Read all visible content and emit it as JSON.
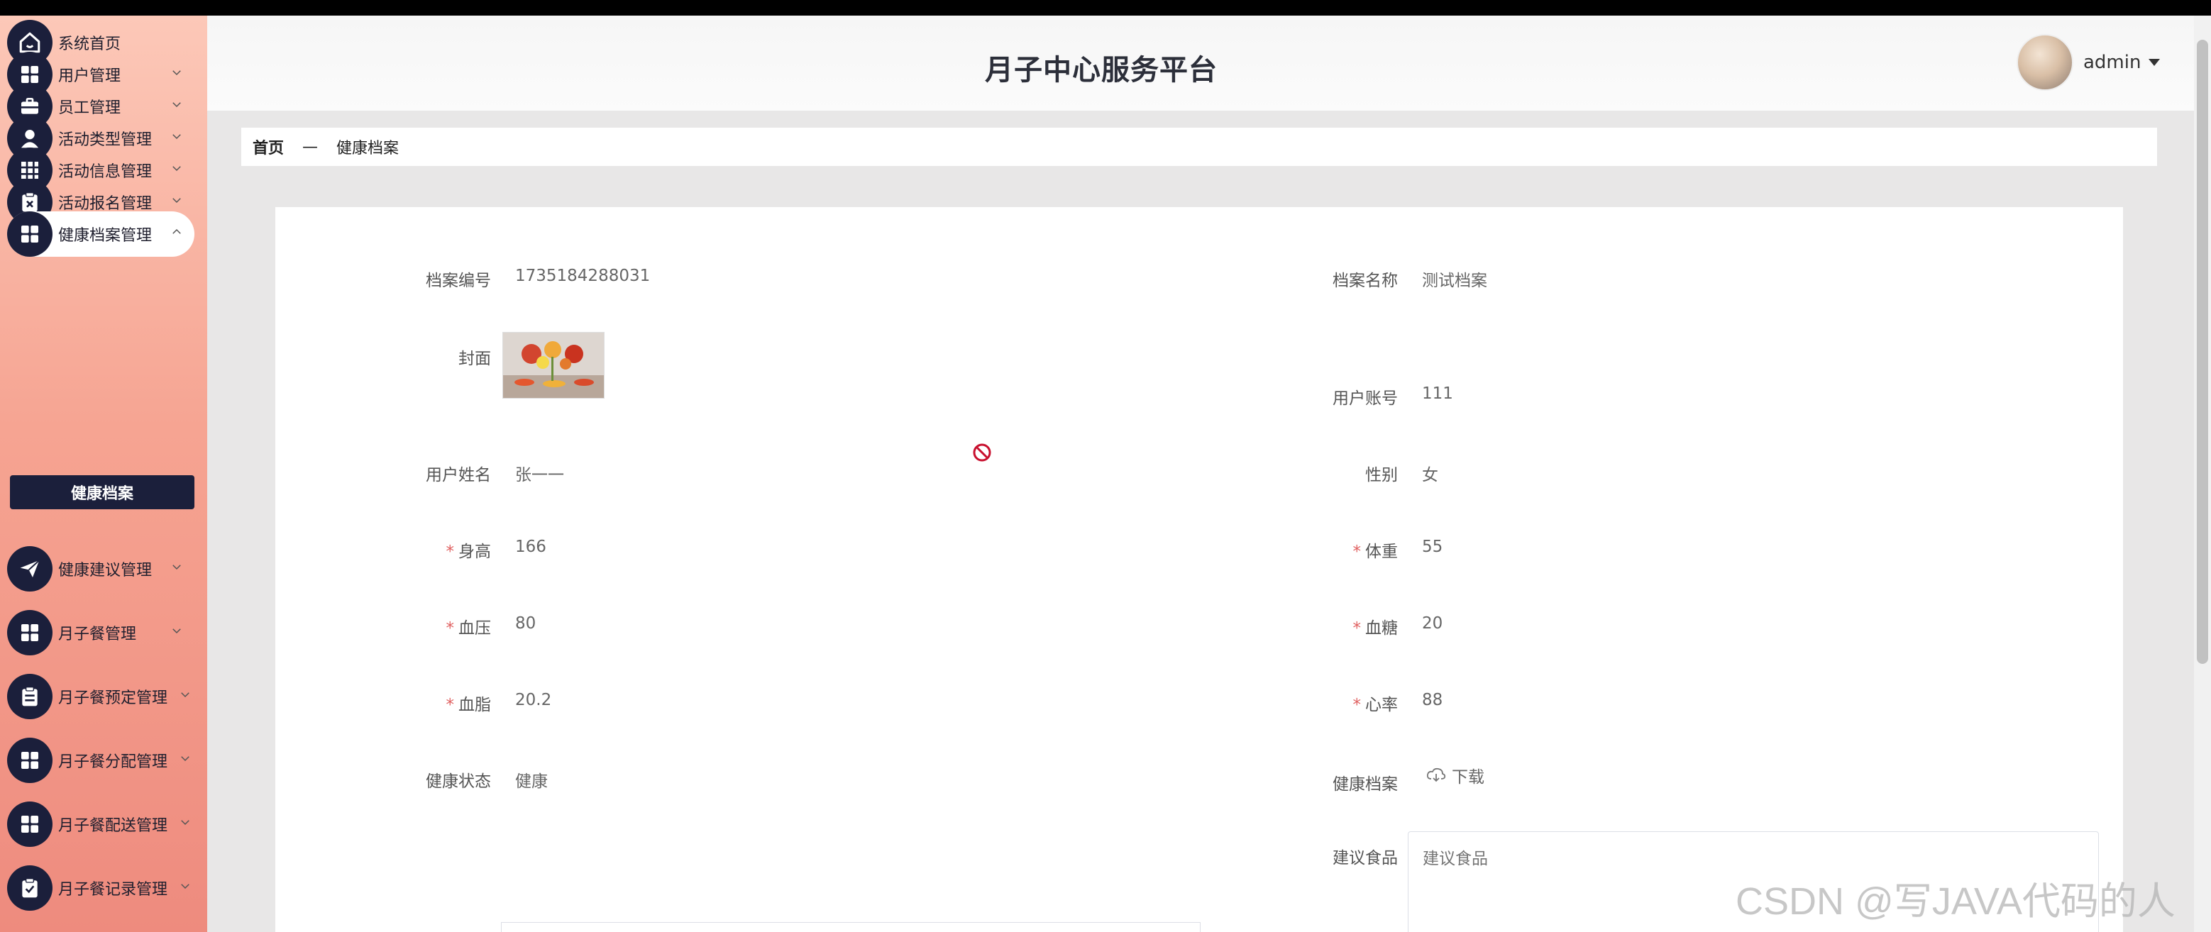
{
  "app": {
    "title": "月子中心服务平台"
  },
  "user": {
    "name": "admin"
  },
  "sidebar": {
    "items": [
      {
        "label": "系统首页",
        "icon": "home-icon",
        "expandable": false
      },
      {
        "label": "用户管理",
        "icon": "grid-icon",
        "expandable": true
      },
      {
        "label": "员工管理",
        "icon": "briefcase-icon",
        "expandable": true
      },
      {
        "label": "活动类型管理",
        "icon": "user-icon",
        "expandable": true
      },
      {
        "label": "活动信息管理",
        "icon": "apps-icon",
        "expandable": true
      },
      {
        "label": "活动报名管理",
        "icon": "clipboard-x-icon",
        "expandable": true
      },
      {
        "label": "健康档案管理",
        "icon": "grid-icon",
        "expandable": true,
        "active": true
      },
      {
        "label": "健康建议管理",
        "icon": "send-icon",
        "expandable": true
      },
      {
        "label": "月子餐管理",
        "icon": "grid-icon",
        "expandable": true
      },
      {
        "label": "月子餐预定管理",
        "icon": "clipboard-icon",
        "expandable": true
      },
      {
        "label": "月子餐分配管理",
        "icon": "grid-icon",
        "expandable": true
      },
      {
        "label": "月子餐配送管理",
        "icon": "grid-icon",
        "expandable": true
      },
      {
        "label": "月子餐记录管理",
        "icon": "clipboard-check-icon",
        "expandable": true
      }
    ],
    "submenu": {
      "label": "健康档案"
    }
  },
  "breadcrumb": {
    "home": "首页",
    "separator": "—",
    "current": "健康档案"
  },
  "form": {
    "record_no": {
      "label": "档案编号",
      "value": "1735184288031"
    },
    "record_name": {
      "label": "档案名称",
      "value": "测试档案"
    },
    "cover": {
      "label": "封面"
    },
    "account": {
      "label": "用户账号",
      "value": "111"
    },
    "username": {
      "label": "用户姓名",
      "value": "张一一"
    },
    "gender": {
      "label": "性别",
      "value": "女"
    },
    "height": {
      "label": "身高",
      "value": "166",
      "required": true
    },
    "weight": {
      "label": "体重",
      "value": "55",
      "required": true
    },
    "blood_pressure": {
      "label": "血压",
      "value": "80",
      "required": true
    },
    "blood_sugar": {
      "label": "血糖",
      "value": "20",
      "required": true
    },
    "blood_lipid": {
      "label": "血脂",
      "value": "20.2",
      "required": true
    },
    "heart_rate": {
      "label": "心率",
      "value": "88",
      "required": true
    },
    "health_status": {
      "label": "健康状态",
      "value": "健康"
    },
    "health_file": {
      "label": "健康档案",
      "download_label": "下载"
    },
    "food": {
      "label": "建议食品",
      "placeholder": "建议食品"
    },
    "required_mark": "*"
  },
  "watermark": "CSDN @写JAVA代码的人",
  "colors": {
    "sidebar_icon_bg": "#1b1f3b",
    "required": "#e06060",
    "sidebar_top": "#fcc8b8",
    "sidebar_bottom": "#ee8b7e"
  }
}
